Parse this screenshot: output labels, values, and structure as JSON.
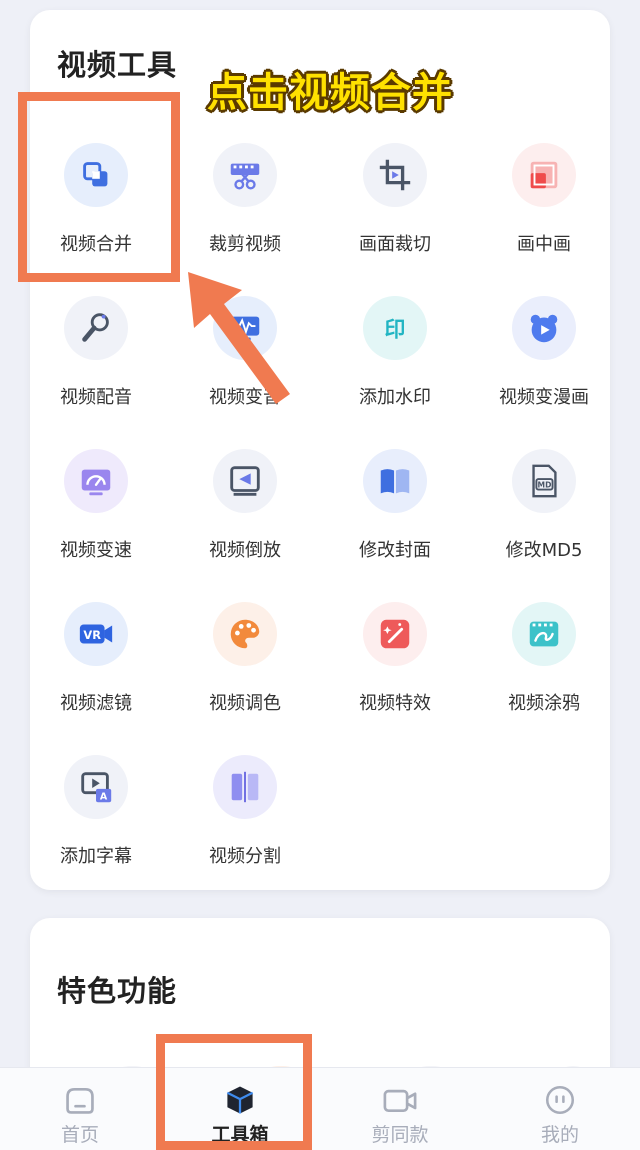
{
  "sections": {
    "video_tools": "视频工具",
    "features": "特色功能"
  },
  "banner": "点击视频合并",
  "tools": [
    {
      "label": "视频合并",
      "icon": "merge-icon"
    },
    {
      "label": "裁剪视频",
      "icon": "film-scissors-icon"
    },
    {
      "label": "画面裁切",
      "icon": "crop-icon"
    },
    {
      "label": "画中画",
      "icon": "picture-in-picture-icon"
    },
    {
      "label": "视频配音",
      "icon": "microphone-icon"
    },
    {
      "label": "视频变音",
      "icon": "waveform-icon"
    },
    {
      "label": "添加水印",
      "icon": "watermark-icon"
    },
    {
      "label": "视频变漫画",
      "icon": "bear-play-icon"
    },
    {
      "label": "视频变速",
      "icon": "speedometer-icon"
    },
    {
      "label": "视频倒放",
      "icon": "reverse-play-icon"
    },
    {
      "label": "修改封面",
      "icon": "book-icon"
    },
    {
      "label": "修改MD5",
      "icon": "md-file-icon"
    },
    {
      "label": "视频滤镜",
      "icon": "vr-camera-icon"
    },
    {
      "label": "视频调色",
      "icon": "palette-icon"
    },
    {
      "label": "视频特效",
      "icon": "magic-wand-icon"
    },
    {
      "label": "视频涂鸦",
      "icon": "doodle-icon"
    },
    {
      "label": "添加字幕",
      "icon": "subtitle-icon"
    },
    {
      "label": "视频分割",
      "icon": "split-icon"
    }
  ],
  "tabs": [
    {
      "label": "首页",
      "icon": "home-icon"
    },
    {
      "label": "工具箱",
      "icon": "toolbox-cube-icon"
    },
    {
      "label": "剪同款",
      "icon": "video-camera-icon"
    },
    {
      "label": "我的",
      "icon": "profile-face-icon"
    }
  ],
  "colors": {
    "highlight": "#f07a50",
    "banner": "#ffe100",
    "accent_blue": "#3f6fe0"
  }
}
